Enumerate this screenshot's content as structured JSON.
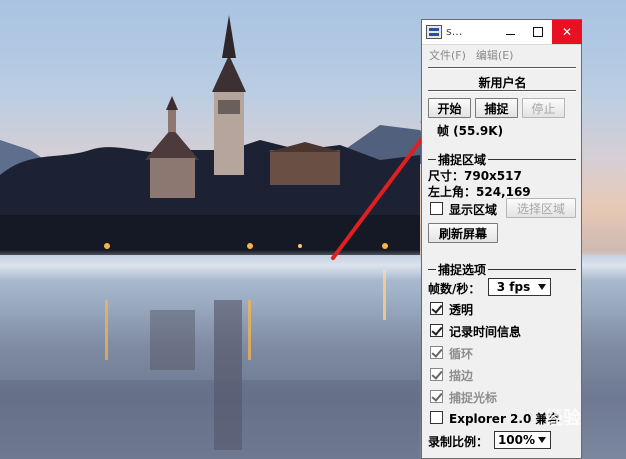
{
  "window": {
    "title": "s...",
    "icon": "camera-app-icon",
    "controls": [
      "minimize",
      "maximize",
      "close"
    ]
  },
  "menu": {
    "items": [
      "文件(F)",
      "编辑(E)"
    ]
  },
  "user": {
    "name": "新用户名"
  },
  "toolbar": {
    "start_label": "开始",
    "capture_label": "捕捉",
    "stop_label": "停止"
  },
  "frame_info": "帧 (55.9K)",
  "capture_area": {
    "group_label": "捕捉区域",
    "size_text": "尺寸：790x517",
    "top_left_text": "左上角：524,169",
    "show_area_label": "显示区域",
    "show_area_checked": false,
    "select_area_label": "选择区域",
    "refresh_label": "刷新屏幕"
  },
  "capture_options": {
    "group_label": "捕捉选项",
    "fps_label": "帧数/秒：",
    "fps_value": "3 fps",
    "checkboxes": [
      {
        "label": "透明",
        "checked": true,
        "enabled": true
      },
      {
        "label": "记录时间信息",
        "checked": true,
        "enabled": true
      },
      {
        "label": "循环",
        "checked": true,
        "enabled": false
      },
      {
        "label": "描边",
        "checked": true,
        "enabled": false
      },
      {
        "label": "捕捉光标",
        "checked": true,
        "enabled": false
      },
      {
        "label": "Explorer 2.0 兼容",
        "checked": false,
        "enabled": true
      }
    ],
    "ratio_label": "录制比例：",
    "ratio_value": "100%"
  },
  "watermark": "经验",
  "colors": {
    "annotation_arrow": "#e02020",
    "close_button": "#e81123"
  }
}
